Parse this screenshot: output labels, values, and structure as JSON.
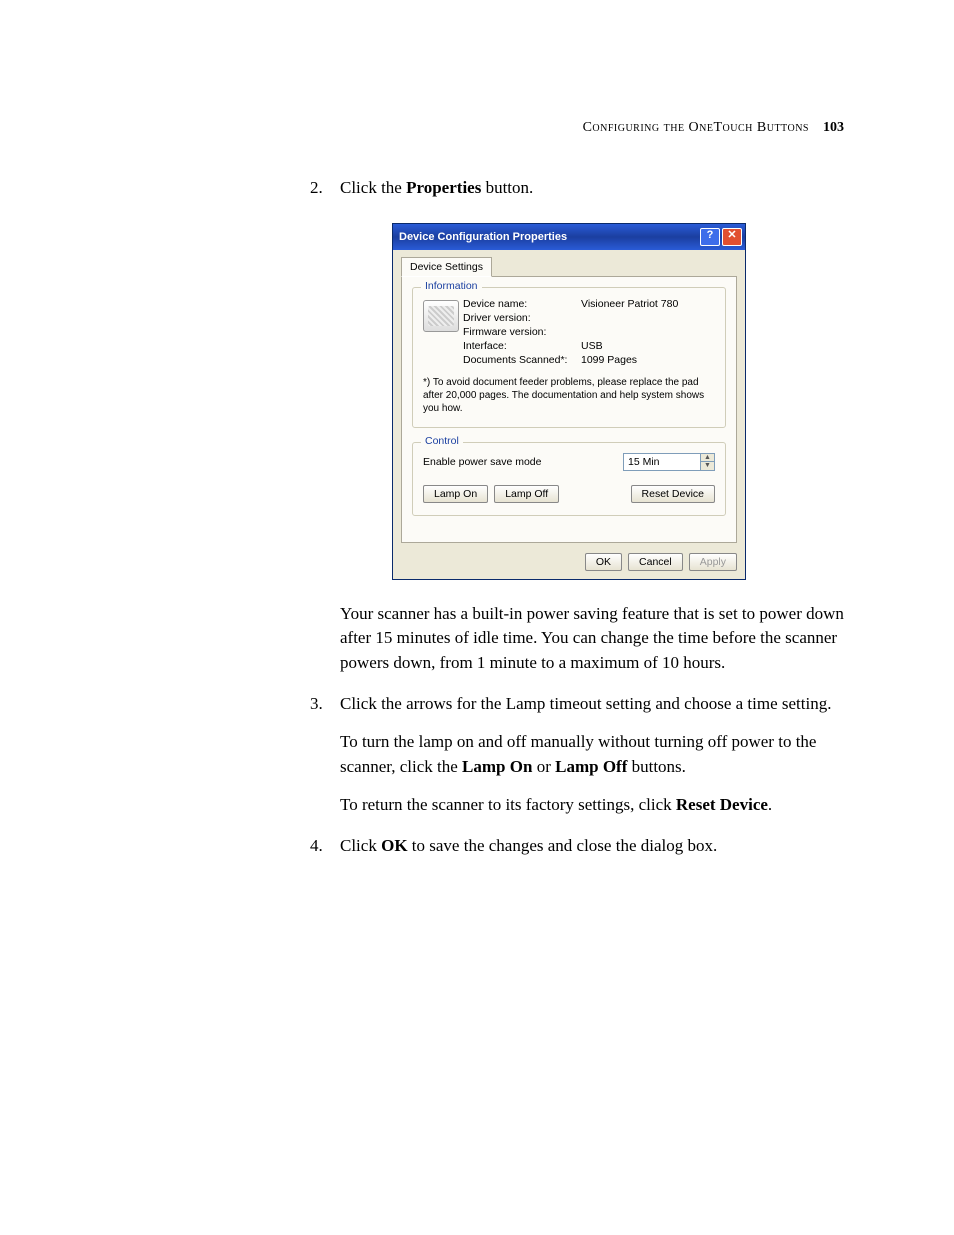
{
  "header": {
    "running_title": "Configuring the OneTouch Buttons",
    "page_number": "103"
  },
  "steps": {
    "s2": {
      "num": "2.",
      "before": "Click the ",
      "bold": "Properties",
      "after": " button."
    },
    "s3": {
      "num": "3.",
      "text": "Click the arrows for the Lamp timeout setting and choose a time setting."
    },
    "s4": {
      "num": "4.",
      "before": "Click ",
      "bold": "OK",
      "after": " to save the changes and close the dialog box."
    }
  },
  "paragraphs": {
    "p1": "Your scanner has a built-in power saving feature that is set to power down after 15 minutes of idle time. You can change the time before the scanner powers down, from 1 minute to a maximum of 10 hours.",
    "p2a": "To turn the lamp on and off manually without turning off power to the scanner, click the ",
    "p2_b1": "Lamp On",
    "p2_mid": " or ",
    "p2_b2": "Lamp Off",
    "p2_end": " buttons.",
    "p3a": "To return the scanner to its factory settings, click ",
    "p3_b": "Reset Device",
    "p3_end": "."
  },
  "dialog": {
    "title": "Device Configuration Properties",
    "tab": "Device Settings",
    "group_info": "Information",
    "labels": {
      "device_name": "Device name:",
      "driver_version": "Driver version:",
      "firmware_version": "Firmware version:",
      "interface": "Interface:",
      "documents_scanned": "Documents Scanned*:"
    },
    "values": {
      "device_name": "Visioneer Patriot 780",
      "driver_version": "",
      "firmware_version": "",
      "interface": "USB",
      "documents_scanned": "1099 Pages"
    },
    "note": "*) To avoid document feeder problems, please replace the pad after 20,000 pages. The documentation and help system shows you how.",
    "group_control": "Control",
    "power_save_label": "Enable power save mode",
    "power_save_value": "15 Min",
    "buttons": {
      "lamp_on": "Lamp On",
      "lamp_off": "Lamp Off",
      "reset": "Reset Device",
      "ok": "OK",
      "cancel": "Cancel",
      "apply": "Apply"
    }
  }
}
